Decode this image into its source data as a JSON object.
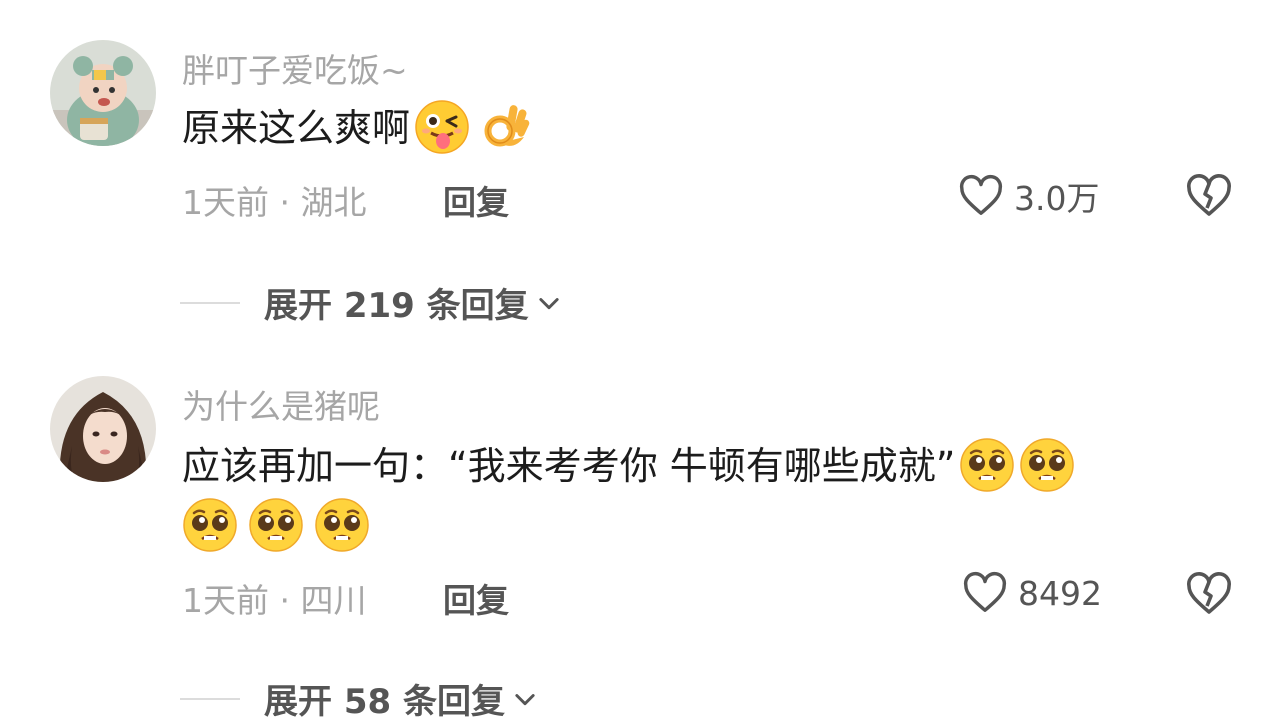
{
  "comments": [
    {
      "username": "胖叮子爱吃饭~",
      "text": "原来这么爽啊",
      "emojis": [
        "tongue-wink-emoji",
        "ok-hand-emoji"
      ],
      "time_location": "1天前 · 湖北",
      "reply_label": "回复",
      "likes": "3.0万",
      "expand_label": "展开 219 条回复"
    },
    {
      "username": "为什么是猪呢",
      "text": "应该再加一句：“我来考考你 牛顿有哪些成就”",
      "emojis": [
        "pleading-face-emoji",
        "pleading-face-emoji",
        "pleading-face-emoji",
        "pleading-face-emoji",
        "pleading-face-emoji"
      ],
      "time_location": "1天前 · 四川",
      "reply_label": "回复",
      "likes": "8492",
      "expand_label": "展开 58 条回复"
    }
  ],
  "colors": {
    "meta_gray": "#a6a6a6",
    "text_dark": "#1c1c1c",
    "action_gray": "#555555"
  }
}
